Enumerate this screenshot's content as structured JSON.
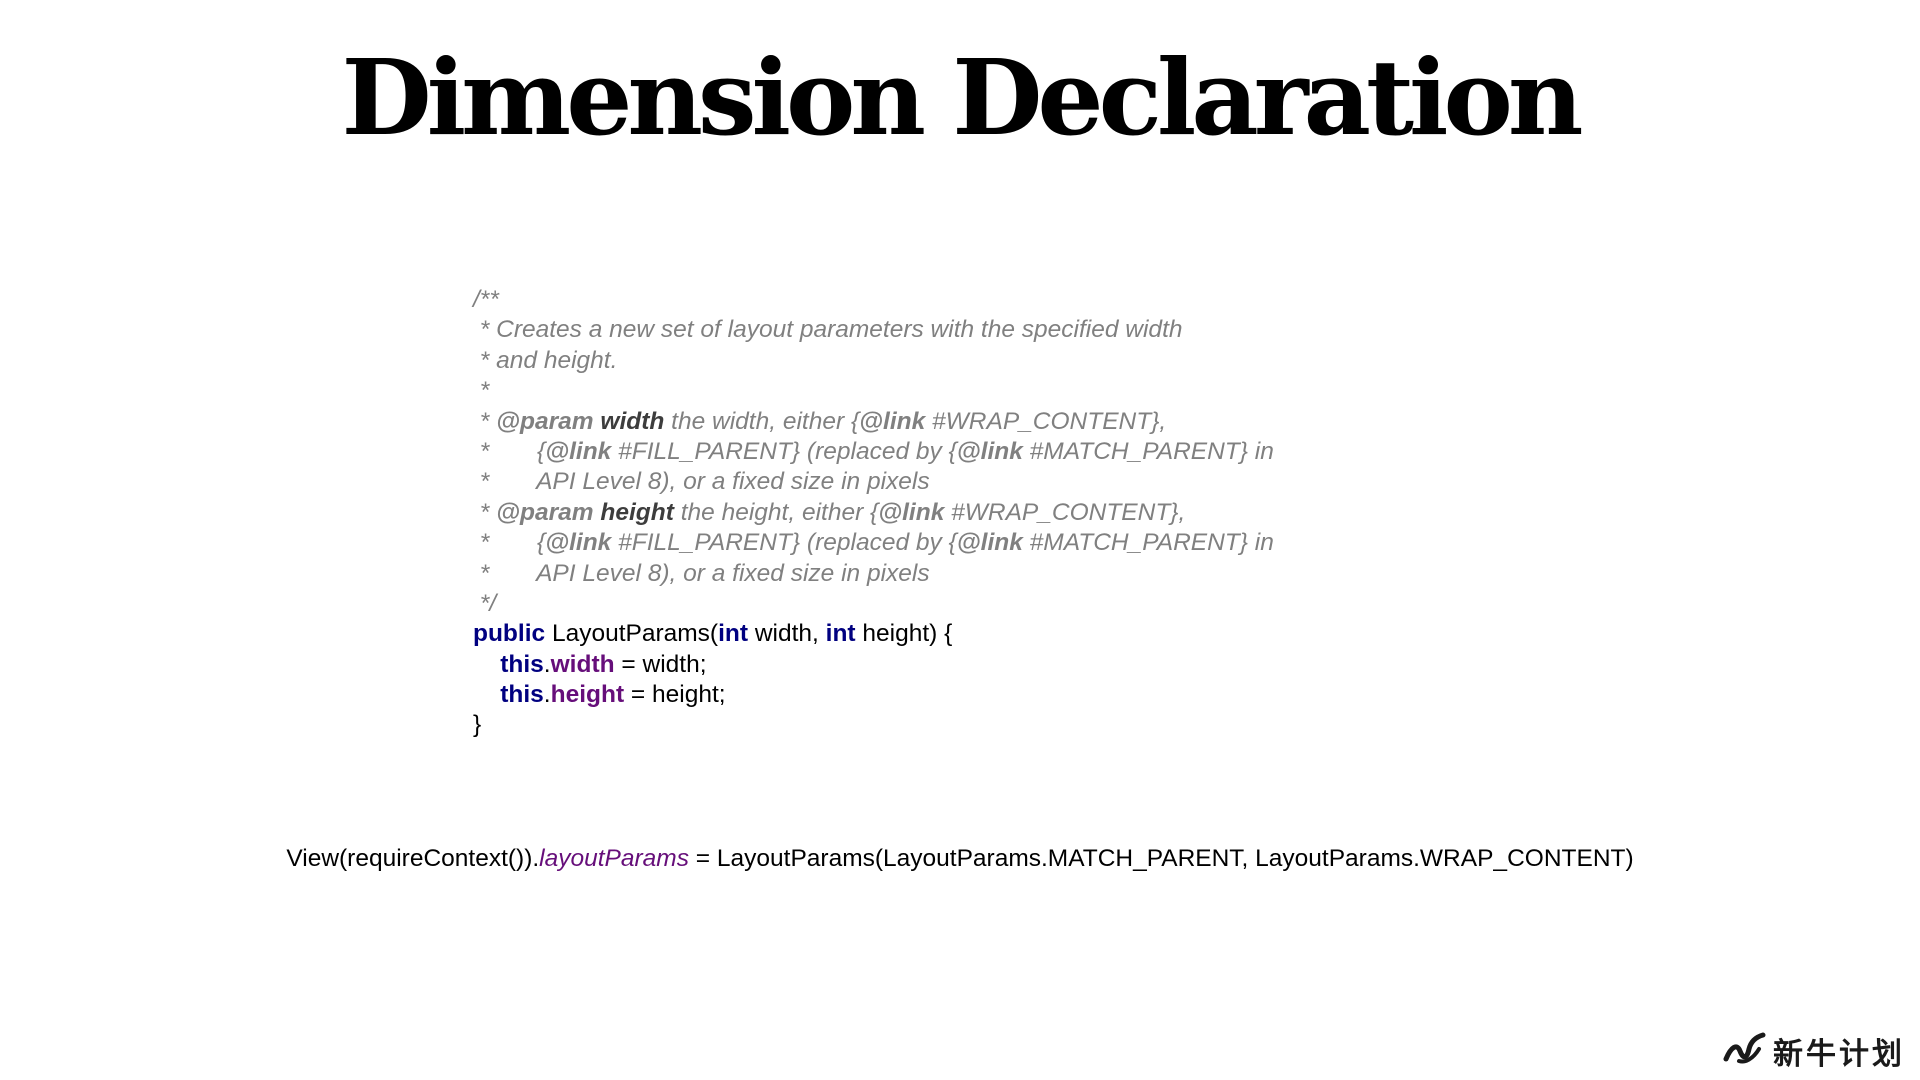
{
  "slide": {
    "title": "Dimension Declaration"
  },
  "javadoc": {
    "open": "/**",
    "l1": " * Creates a new set of layout parameters with the specified width",
    "l2": " * and height.",
    "l3": " *",
    "p1_prefix": " * ",
    "p1_tag": "@param",
    "p1_name": "width",
    "p1_text": " the width, either {",
    "link_tag": "@link",
    "p1_link1": " #WRAP_CONTENT},",
    "p1_cont1_prefix": " *       {",
    "p1_cont1_link1": " #FILL_PARENT} (replaced by {",
    "p1_cont1_link2": " #MATCH_PARENT} in",
    "p1_cont2": " *       API Level 8), or a fixed size in pixels",
    "p2_prefix": " * ",
    "p2_tag": "@param",
    "p2_name": "height",
    "p2_text": " the height, either {",
    "p2_link1": " #WRAP_CONTENT},",
    "p2_cont1_prefix": " *       {",
    "p2_cont1_link1": " #FILL_PARENT} (replaced by {",
    "p2_cont1_link2": " #MATCH_PARENT} in",
    "p2_cont2": " *       API Level 8), or a fixed size in pixels",
    "close": " */"
  },
  "code": {
    "kw_public": "public",
    "ctor_sig": " LayoutParams(",
    "kw_int": "int",
    "arg_width": " width, ",
    "arg_height": " height) {",
    "indent": "    ",
    "kw_this": "this",
    "dot": ".",
    "field_width": "width",
    "assign_width": " = width;",
    "field_height": "height",
    "assign_height": " = height;",
    "close_brace": "}"
  },
  "usage": {
    "prefix": "View(requireContext()).",
    "property": "layoutParams",
    "suffix": " = LayoutParams(LayoutParams.MATCH_PARENT, LayoutParams.WRAP_CONTENT)"
  },
  "brand": {
    "icon": "niu-logo-icon",
    "text": "新牛计划"
  }
}
